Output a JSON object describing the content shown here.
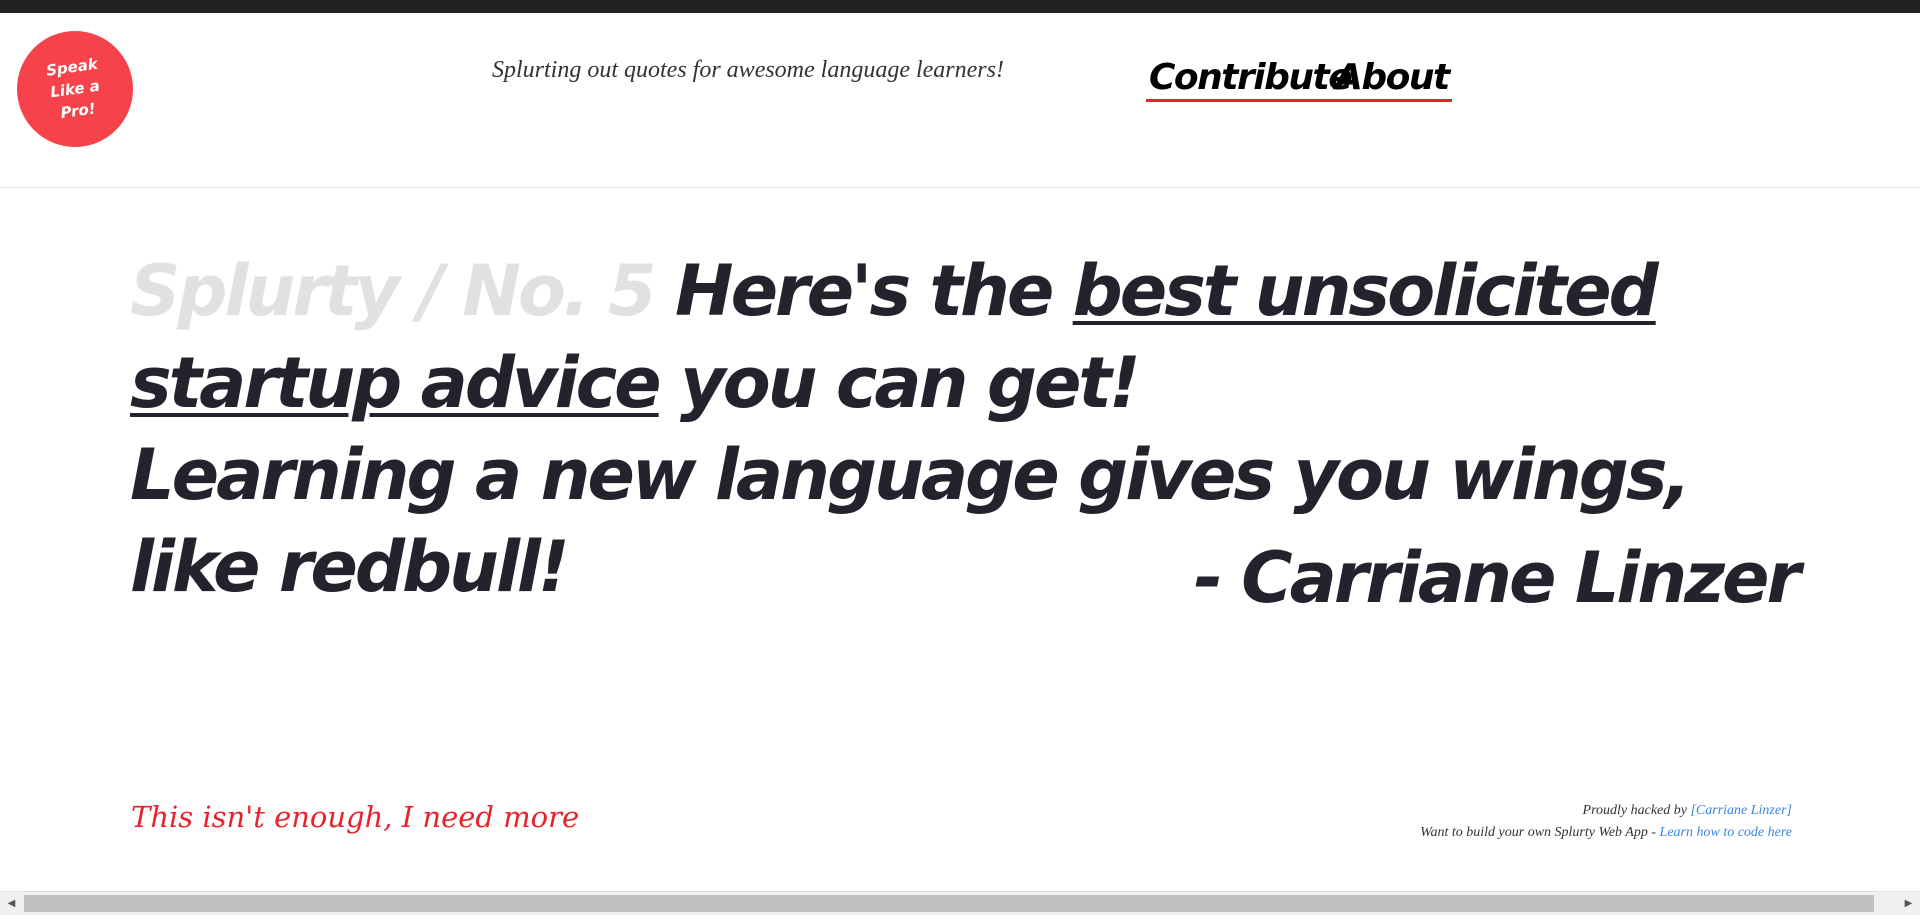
{
  "header": {
    "logo_text": "Speak Like a Pro!",
    "tagline": "Splurting out quotes for awesome language learners!",
    "nav": {
      "contribute": "Contribute",
      "about": "About"
    }
  },
  "quote": {
    "prefix": "Splurty / No. 5",
    "intro_before": "Here's the",
    "intro_link": "best unsolicited startup advice",
    "intro_after": "you can get!",
    "text": "Learning a new language gives you wings, like redbull!",
    "author": "- Carriane Linzer"
  },
  "more_link": "This isn't enough, I need more",
  "footer": {
    "hacked_by_prefix": "Proudly hacked by",
    "hacked_by_link": "[Carriane Linzer]",
    "build_prefix": "Want to build your own Splurty Web App -",
    "build_link": "Learn how to code here"
  },
  "colors": {
    "accent_red": "#f5424b",
    "link_blue": "#3a86e0",
    "muted_gray": "#e1e1e1",
    "text_dark": "#23232d"
  }
}
